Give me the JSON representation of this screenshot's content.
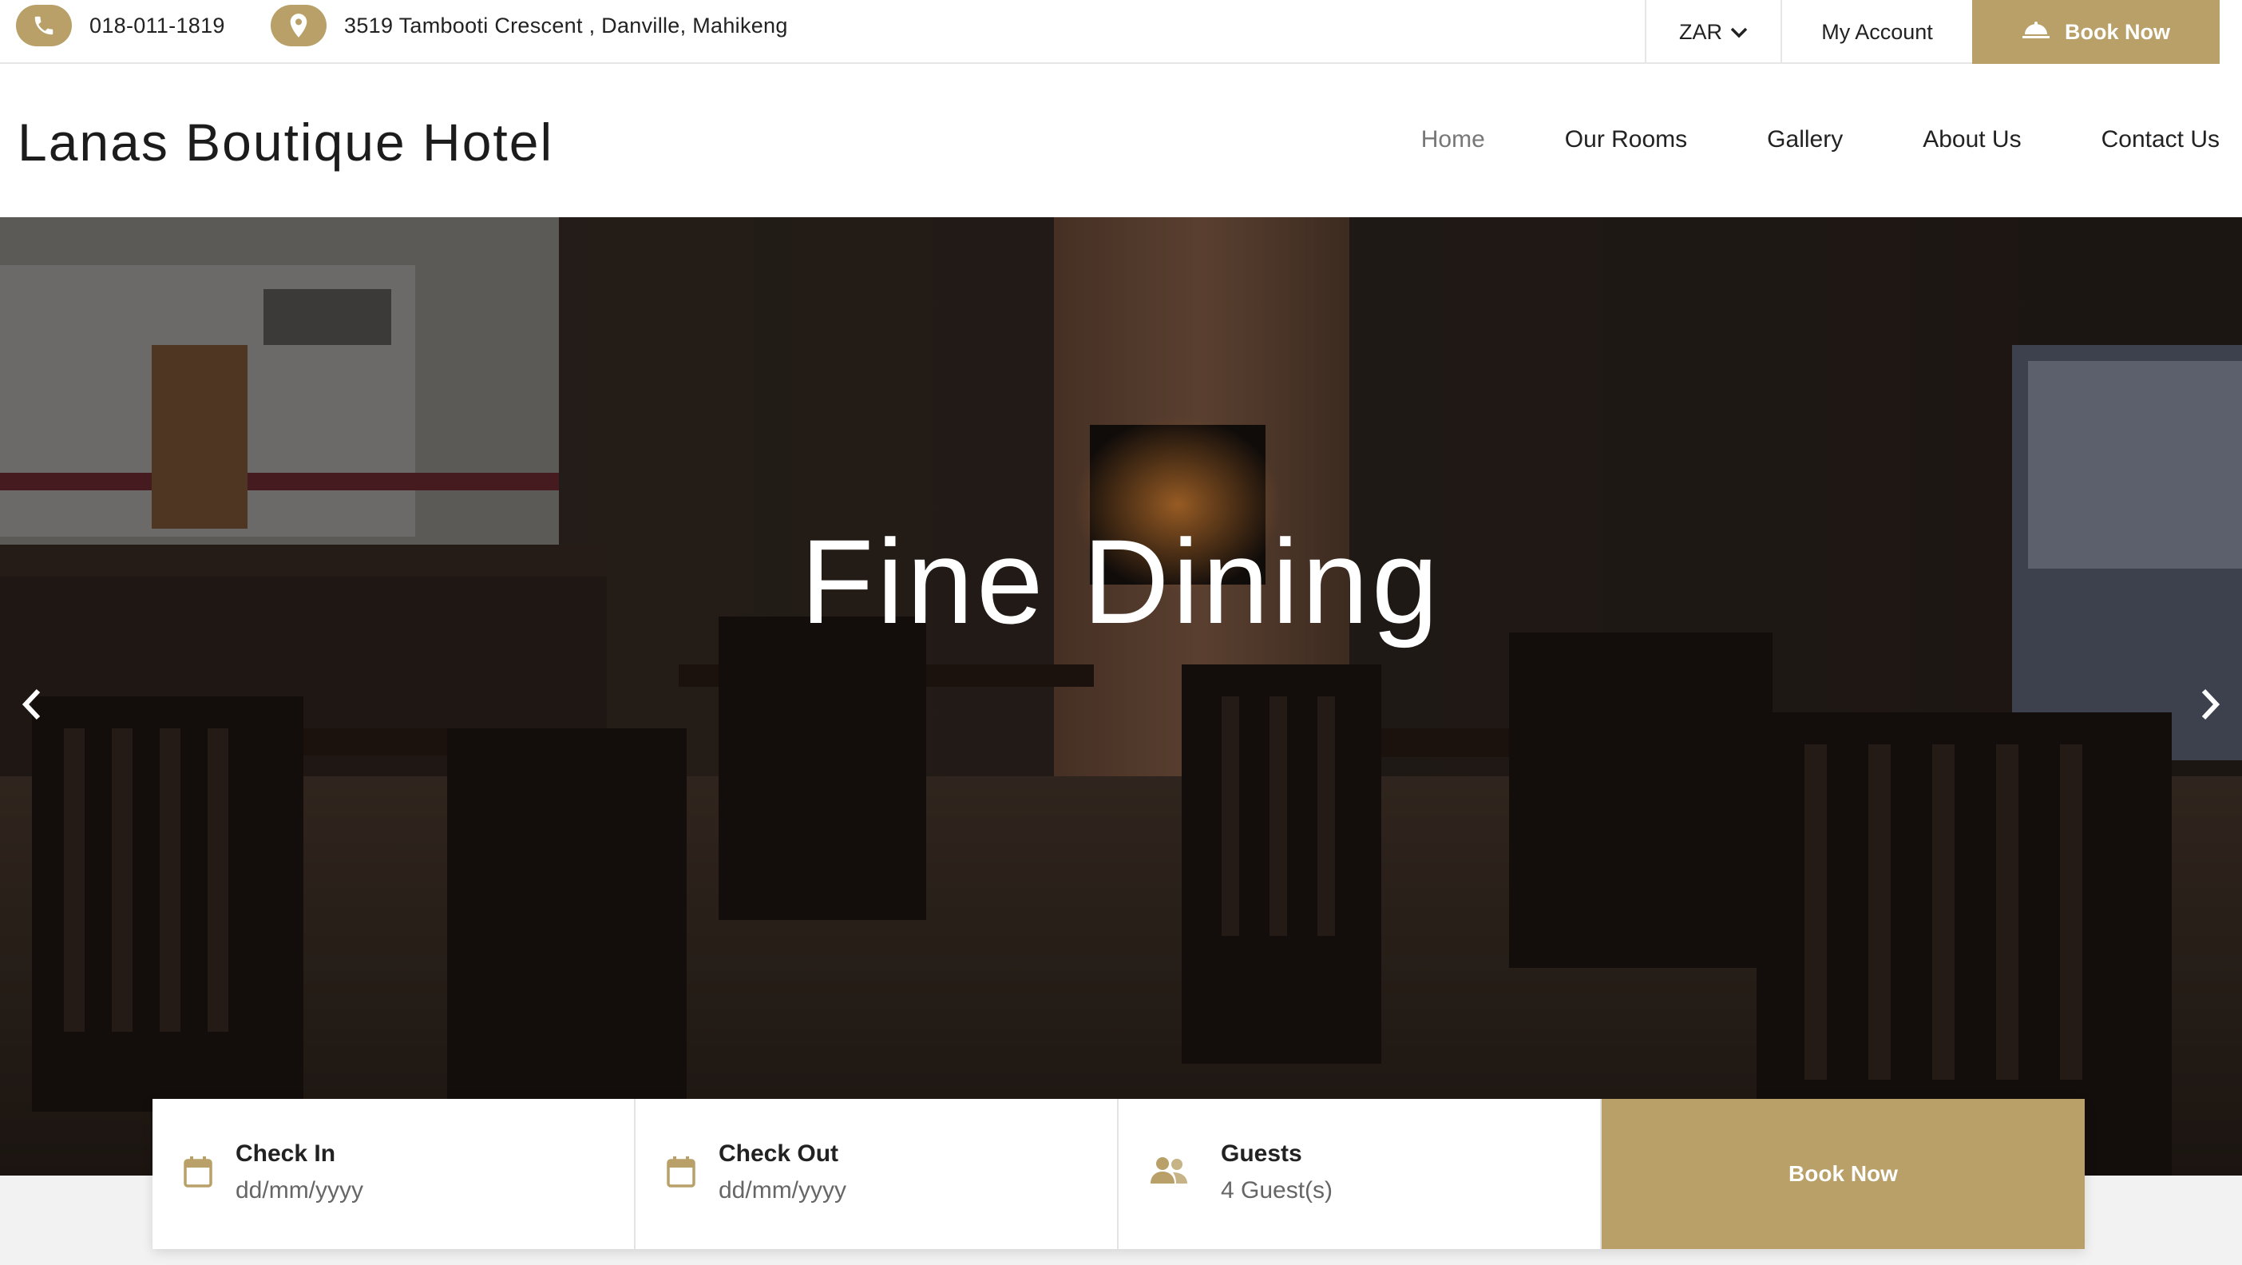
{
  "topbar": {
    "phone": "018-011-1819",
    "address": "3519 Tambooti Crescent , Danville, Mahikeng",
    "currency": "ZAR",
    "account_label": "My Account",
    "book_label": "Book Now"
  },
  "header": {
    "logo": "Lanas Boutique Hotel",
    "nav": [
      {
        "label": "Home",
        "active": true
      },
      {
        "label": "Our Rooms"
      },
      {
        "label": "Gallery"
      },
      {
        "label": "About Us"
      },
      {
        "label": "Contact Us"
      }
    ]
  },
  "hero": {
    "title": "Fine Dining"
  },
  "booking": {
    "check_in_label": "Check In",
    "check_in_placeholder": "dd/mm/yyyy",
    "check_out_label": "Check Out",
    "check_out_placeholder": "dd/mm/yyyy",
    "guests_label": "Guests",
    "guests_value": "4 Guest(s)",
    "submit_label": "Book Now"
  },
  "colors": {
    "accent": "#b8a068",
    "white": "#ffffff",
    "text": "#222222"
  },
  "icons": [
    "phone-icon",
    "map-pin-icon",
    "chevron-down-icon",
    "room-service-icon",
    "chevron-left-icon",
    "chevron-right-icon",
    "calendar-icon",
    "users-icon"
  ]
}
